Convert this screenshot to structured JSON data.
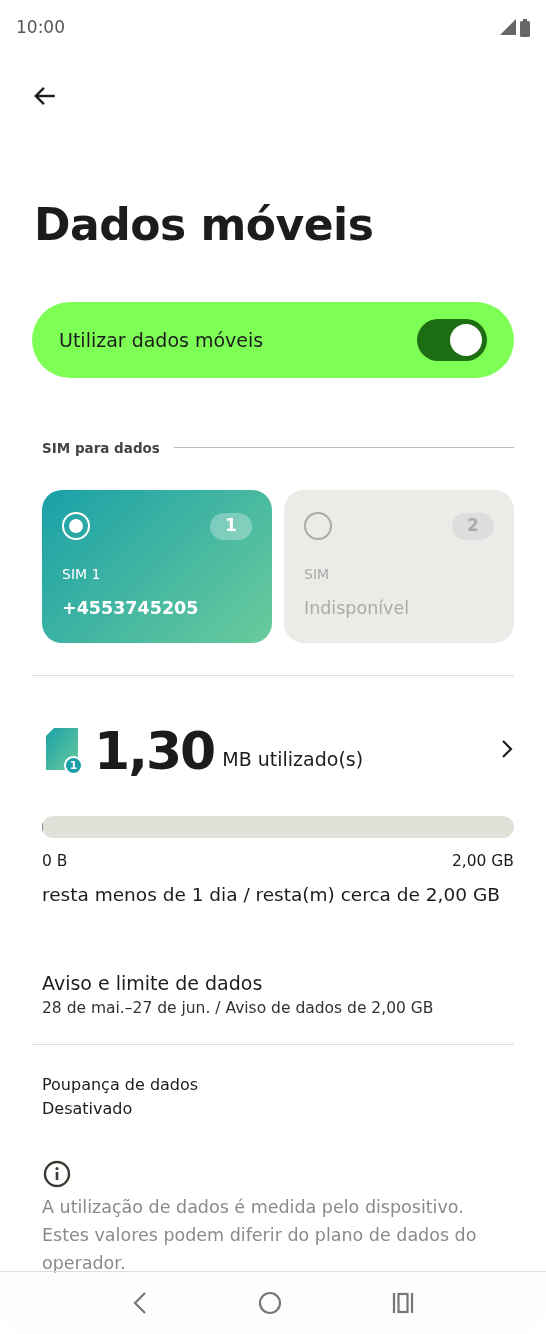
{
  "status_bar": {
    "time": "10:00"
  },
  "title": "Dados móveis",
  "mobile_data": {
    "label": "Utilizar dados móveis",
    "on": true
  },
  "sim_section": {
    "title": "SIM para dados"
  },
  "sims": [
    {
      "slot": "1",
      "label": "SIM 1",
      "value": "+4553745205",
      "selected": true
    },
    {
      "slot": "2",
      "label": "SIM",
      "value": "Indisponível",
      "selected": false
    }
  ],
  "usage": {
    "sim_badge": "1",
    "amount": "1,30",
    "unit": "MB utilizado(s)",
    "level": 0,
    "min_label": "0 B",
    "max_label": "2,00 GB",
    "remaining": "resta menos de 1 dia / resta(m) cerca de 2,00 GB"
  },
  "settings": [
    {
      "title": "Aviso e limite de dados",
      "subtitle": "28 de mai.–27 de jun. / Aviso de dados de 2,00 GB"
    },
    {
      "title": "Poupança de dados",
      "subtitle": "Desativado"
    }
  ],
  "footer_note": "A utilização de dados é medida pelo dispositivo. Estes valores podem diferir do plano de dados do operador."
}
